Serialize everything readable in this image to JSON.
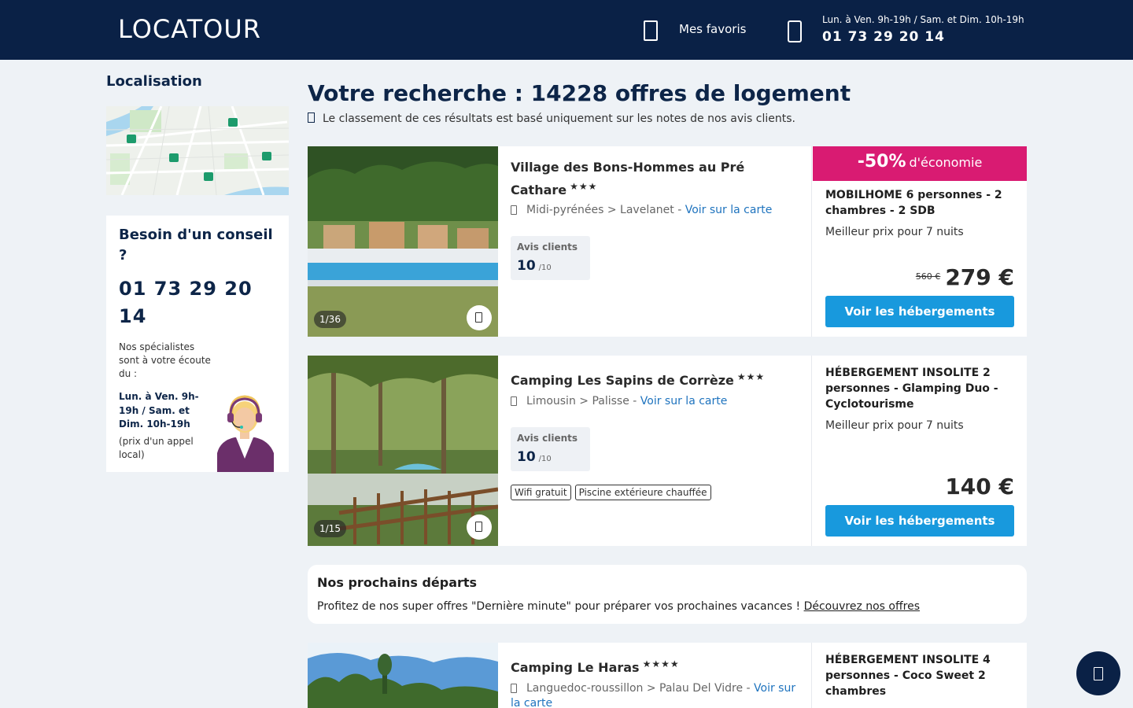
{
  "header": {
    "logo": "LOCATOUR",
    "favorites_label": "Mes favoris",
    "hours": "Lun. à Ven. 9h-19h / Sam. et Dim. 10h-19h",
    "phone": "01 73 29 20 14"
  },
  "sidebar": {
    "localisation_title": "Localisation",
    "advice": {
      "title": "Besoin d'un conseil ?",
      "phone": "01 73 29 20 14",
      "text": "Nos spécialistes sont à votre écoute du :",
      "hours": "Lun. à Ven. 9h-19h / Sam. et Dim. 10h-19h",
      "note": "(prix d'un appel local)"
    }
  },
  "search": {
    "title_prefix": "Votre recherche : ",
    "count": "14228",
    "title_suffix": " offres de logement",
    "info": "Le classement de ces résultats est basé uniquement sur les notes de nos avis clients."
  },
  "results": [
    {
      "name": "Village des Bons-Hommes au Pré Cathare",
      "stars": "★★★",
      "region": "Midi-pyrénées > Lavelanet - ",
      "map_link": "Voir sur la carte",
      "rating_label": "Avis clients",
      "rating": "10",
      "rating_scale": "/10",
      "photo_count": "1/36",
      "discount_pct": "-50%",
      "discount_label": "d'économie",
      "offer_title": "MOBILHOME 6 personnes - 2 chambres - 2 SDB",
      "offer_sub": "Meilleur prix pour 7 nuits",
      "old_price": "560 €",
      "price": "279 €",
      "cta": "Voir les hébergements"
    },
    {
      "name": "Camping Les Sapins de Corrèze",
      "stars": "★★★",
      "region": "Limousin > Palisse - ",
      "map_link": "Voir sur la carte",
      "rating_label": "Avis clients",
      "rating": "10",
      "rating_scale": "/10",
      "photo_count": "1/15",
      "tags": [
        "Wifi gratuit",
        "Piscine extérieure chauffée"
      ],
      "offer_title": "HÉBERGEMENT INSOLITE 2 personnes - Glamping Duo - Cyclotourisme",
      "offer_sub": "Meilleur prix pour 7 nuits",
      "price": "140 €",
      "cta": "Voir les hébergements"
    },
    {
      "name": "Camping Le Haras",
      "stars": "★★★★",
      "region": "Languedoc-roussillon > Palau Del Vidre - ",
      "map_link": "Voir sur la carte",
      "offer_title": "HÉBERGEMENT INSOLITE 4 personnes - Coco Sweet 2 chambres"
    }
  ],
  "departures": {
    "title": "Nos prochains départs",
    "text": "Profitez de nos super offres \"Dernière minute\" pour préparer vos prochaines vacances ! ",
    "link": "Découvrez nos offres"
  },
  "colors": {
    "header_bg": "#0a2146",
    "accent_blue": "#1899dd",
    "discount_pink": "#d91b72",
    "link_blue": "#1e73be"
  },
  "icons": [
    "heart-icon",
    "phone-icon",
    "info-icon",
    "map-pin-icon",
    "chat-icon"
  ]
}
